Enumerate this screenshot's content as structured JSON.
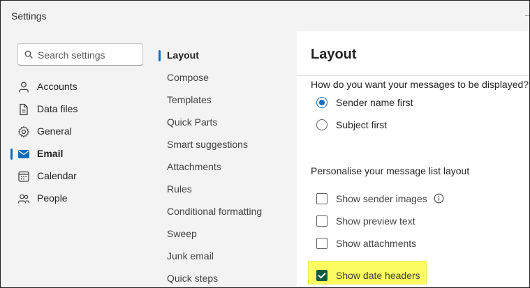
{
  "window": {
    "title": "Settings"
  },
  "search": {
    "placeholder": "Search settings"
  },
  "leftnav": {
    "items": [
      {
        "label": "Accounts",
        "icon": "person-icon"
      },
      {
        "label": "Data files",
        "icon": "document-icon"
      },
      {
        "label": "General",
        "icon": "gear-icon"
      },
      {
        "label": "Email",
        "icon": "mail-icon",
        "active": true
      },
      {
        "label": "Calendar",
        "icon": "calendar-icon"
      },
      {
        "label": "People",
        "icon": "people-icon"
      }
    ]
  },
  "midnav": {
    "items": [
      {
        "label": "Layout",
        "active": true
      },
      {
        "label": "Compose"
      },
      {
        "label": "Templates"
      },
      {
        "label": "Quick Parts"
      },
      {
        "label": "Smart suggestions"
      },
      {
        "label": "Attachments"
      },
      {
        "label": "Rules"
      },
      {
        "label": "Conditional formatting"
      },
      {
        "label": "Sweep"
      },
      {
        "label": "Junk email"
      },
      {
        "label": "Quick steps"
      }
    ]
  },
  "content": {
    "heading": "Layout",
    "question": "How do you want your messages to be displayed?",
    "radios": [
      {
        "label": "Sender name first",
        "checked": true
      },
      {
        "label": "Subject first",
        "checked": false
      }
    ],
    "section_title": "Personalise your message list layout",
    "checkboxes": [
      {
        "label": "Show sender images",
        "checked": false
      },
      {
        "label": "Show preview text",
        "checked": false
      },
      {
        "label": "Show attachments",
        "checked": false
      },
      {
        "label": "Show date headers",
        "checked": true
      }
    ]
  },
  "colors": {
    "accent": "#0f6cbd",
    "checked_box": "#0e5a3c",
    "highlight": "#fcfc62",
    "pane_bg": "#f3f3f3"
  }
}
